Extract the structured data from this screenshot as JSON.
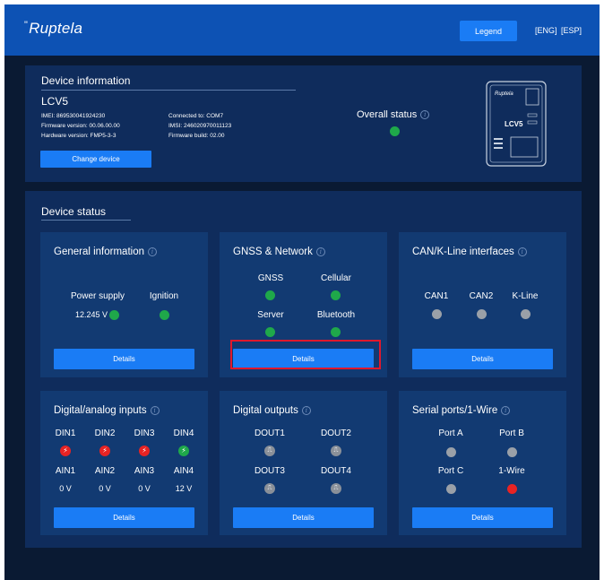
{
  "header": {
    "logo": "Ruptela",
    "logo_mark": "\"",
    "legend_label": "Legend",
    "lang_eng": "[ENG]",
    "lang_esp": "[ESP]"
  },
  "device_info": {
    "title": "Device information",
    "name": "LCV5",
    "imei": "IMEI: 869530041924230",
    "firmware": "Firmware version: 00.06.00.00",
    "hardware": "Hardware version: FMP5-3-3",
    "connected": "Connected to: COM7",
    "imsi": "IMSI: 246020970011123",
    "firmware_build": "Firmware build: 02.00",
    "change_label": "Change device",
    "overall_label": "Overall status",
    "image_brand": "Ruptela",
    "image_model": "LCV5"
  },
  "device_status": {
    "title": "Device status",
    "details_label": "Details",
    "general": {
      "title": "General information",
      "power": "Power supply",
      "power_value": "12.245 V",
      "ignition": "Ignition"
    },
    "gnss": {
      "title": "GNSS & Network",
      "gnss": "GNSS",
      "cellular": "Cellular",
      "server": "Server",
      "bluetooth": "Bluetooth"
    },
    "can": {
      "title": "CAN/K-Line interfaces",
      "can1": "CAN1",
      "can2": "CAN2",
      "kline": "K-Line"
    },
    "dio": {
      "title": "Digital/analog inputs",
      "din": [
        "DIN1",
        "DIN2",
        "DIN3",
        "DIN4"
      ],
      "ain": [
        "AIN1",
        "AIN2",
        "AIN3",
        "AIN4"
      ],
      "ain_values": [
        "0 V",
        "0 V",
        "0 V",
        "12 V"
      ]
    },
    "dout": {
      "title": "Digital outputs",
      "labels": [
        "DOUT1",
        "DOUT2",
        "DOUT3",
        "DOUT4"
      ]
    },
    "serial": {
      "title": "Serial ports/1-Wire",
      "port_a": "Port A",
      "port_b": "Port B",
      "port_c": "Port C",
      "wire": "1-Wire"
    }
  },
  "colors": {
    "header": "#0d52b4",
    "button": "#1a7cf5",
    "ok": "#1fa84a",
    "error": "#e82323",
    "inactive": "#9aa0a8",
    "highlight": "#e0182c"
  }
}
